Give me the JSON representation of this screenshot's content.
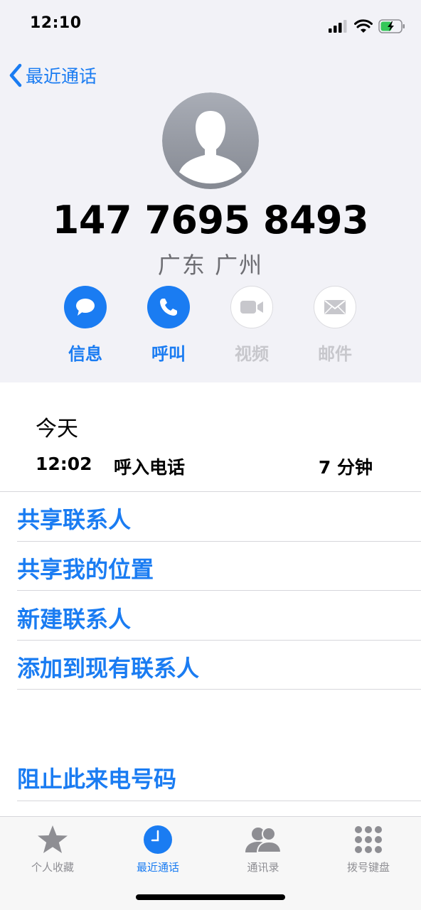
{
  "status": {
    "time": "12:10"
  },
  "nav": {
    "back_label": "最近通话"
  },
  "contact": {
    "number": "147 7695 8493",
    "location": "广东 广州"
  },
  "actions": [
    {
      "label": "信息",
      "icon": "message-icon",
      "enabled": true
    },
    {
      "label": "呼叫",
      "icon": "phone-icon",
      "enabled": true
    },
    {
      "label": "视频",
      "icon": "video-icon",
      "enabled": false
    },
    {
      "label": "邮件",
      "icon": "mail-icon",
      "enabled": false
    }
  ],
  "history": {
    "day": "今天",
    "time": "12:02",
    "type": "呼入电话",
    "duration": "7 分钟"
  },
  "options": [
    "共享联系人",
    "共享我的位置",
    "新建联系人",
    "添加到现有联系人"
  ],
  "block_label": "阻止此来电号码",
  "tabs": [
    {
      "label": "个人收藏",
      "icon": "star-icon",
      "active": false
    },
    {
      "label": "最近通话",
      "icon": "clock-icon",
      "active": true
    },
    {
      "label": "通讯录",
      "icon": "contacts-icon",
      "active": false
    },
    {
      "label": "拨号键盘",
      "icon": "keypad-icon",
      "active": false
    }
  ],
  "colors": {
    "accent": "#1a7cf2",
    "disabled": "#c7c7cc",
    "header_bg": "#f2f2f7"
  }
}
